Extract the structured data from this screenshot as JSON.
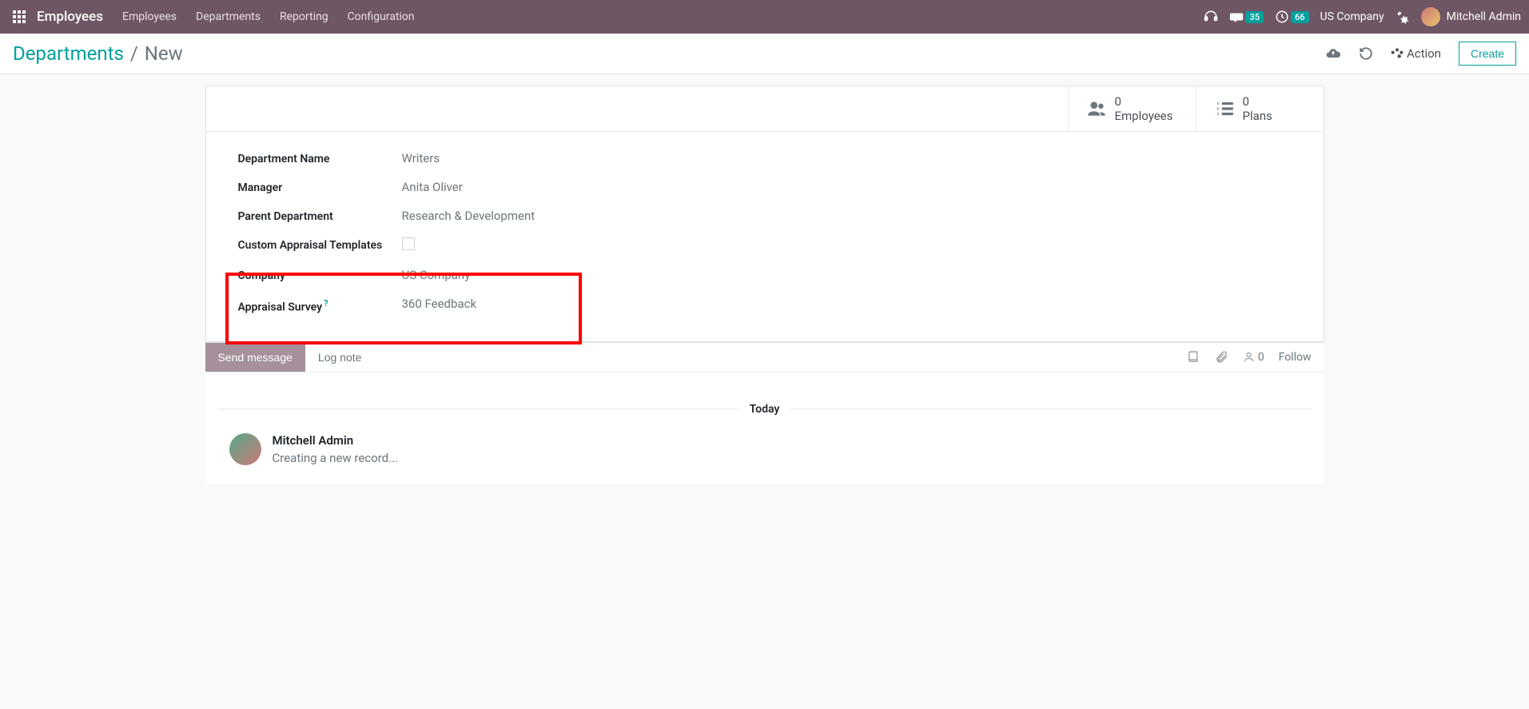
{
  "nav": {
    "brand": "Employees",
    "menu": [
      "Employees",
      "Departments",
      "Reporting",
      "Configuration"
    ],
    "msg_count": "35",
    "activity_count": "66",
    "company": "US Company",
    "user": "Mitchell Admin"
  },
  "breadcrumb": {
    "root": "Departments",
    "current": "New"
  },
  "controls": {
    "action_label": "Action",
    "create_label": "Create"
  },
  "stats": {
    "employees_count": "0",
    "employees_label": "Employees",
    "plans_count": "0",
    "plans_label": "Plans"
  },
  "form": {
    "dept_name_label": "Department Name",
    "dept_name_value": "Writers",
    "manager_label": "Manager",
    "manager_value": "Anita Oliver",
    "parent_label": "Parent Department",
    "parent_value": "Research & Development",
    "custom_appraisal_label": "Custom Appraisal Templates",
    "company_label": "Company",
    "company_value": "US Company",
    "survey_label": "Appraisal Survey",
    "survey_value": "360 Feedback"
  },
  "chatter": {
    "send_label": "Send message",
    "log_label": "Log note",
    "follower_count": "0",
    "follow_label": "Follow",
    "separator": "Today",
    "msg_author": "Mitchell Admin",
    "msg_text": "Creating a new record..."
  }
}
